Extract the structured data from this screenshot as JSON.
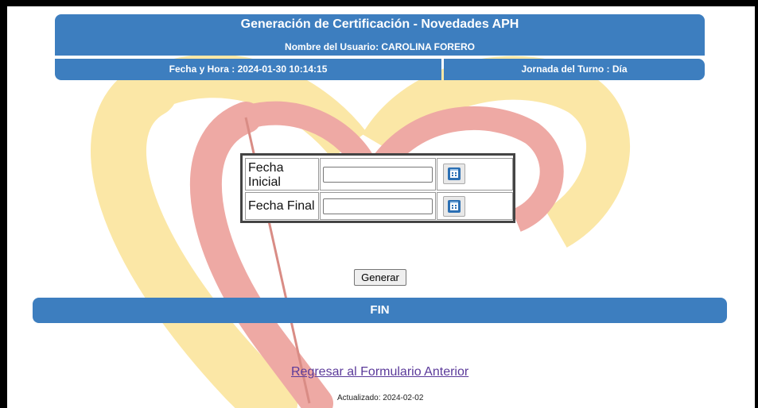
{
  "header": {
    "title": "Generación de Certificación - Novedades APH",
    "user_line": "Nombre del Usuario: CAROLINA FORERO"
  },
  "info": {
    "datetime": "Fecha y Hora : 2024-01-30 10:14:15",
    "shift": "Jornada del Turno : Día"
  },
  "form": {
    "start_label": "Fecha Inicial",
    "end_label": "Fecha Final",
    "start_value": "",
    "end_value": "",
    "calendar_icon": "calendar-icon"
  },
  "actions": {
    "generate_label": "Generar"
  },
  "footer": {
    "fin_label": "FIN",
    "back_link": "Regresar al Formulario Anterior",
    "updated": "Actualizado: 2024-02-02"
  },
  "colors": {
    "bar": "#3d7ebf",
    "heart_yellow": "#fbe7a6",
    "heart_pink": "#eea9a4",
    "link": "#5b3a9a"
  }
}
